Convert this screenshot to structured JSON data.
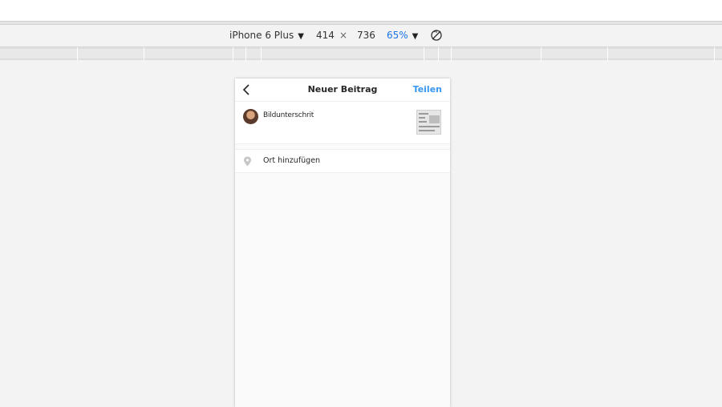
{
  "device_toolbar": {
    "device_name": "iPhone 6 Plus",
    "width": "414",
    "times": "×",
    "height": "736",
    "zoom": "65%"
  },
  "phone": {
    "header": {
      "title": "Neuer Beitrag",
      "share_label": "Teilen"
    },
    "caption": {
      "placeholder": "Bildunterschrit"
    },
    "location": {
      "label": "Ort hinzufügen"
    }
  },
  "colors": {
    "accent": "#3897f0",
    "zoom": "#1a73e8"
  },
  "icons": [
    "chevron-down-icon",
    "rotate-icon",
    "back-arrow-icon",
    "location-pin-icon"
  ]
}
